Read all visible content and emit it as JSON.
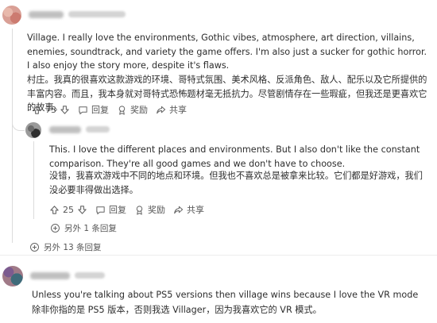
{
  "comment1": {
    "text_en": "Village. I really love the environments, Gothic vibes, atmosphere, art direction, villains, enemies, soundtrack, and variety the game offers. I'm also just a sucker for gothic horror. I also enjoy the story more, despite it's flaws.",
    "text_cn": "村庄。我真的很喜欢这款游戏的环境、哥特式氛围、美术风格、反派角色、敌人、配乐以及它所提供的丰富内容。而且，我本身就对哥特式恐怖题材毫无抵抗力。尽管剧情存在一些瑕疵，但我还是更喜欢它的故事。",
    "votes": "73",
    "reply_label": "回复",
    "award_label": "奖励",
    "share_label": "共享",
    "more_replies": "另外 13 条回复"
  },
  "comment2": {
    "text_en": "This. I love the different places and environments. But I also don't like the constant comparison. They're all good games and we don't have to choose.",
    "text_cn": "没错，我喜欢游戏中不同的地点和环境。但我也不喜欢总是被拿来比较。它们都是好游戏，我们没必要非得做出选择。",
    "votes": "25",
    "reply_label": "回复",
    "award_label": "奖励",
    "share_label": "共享",
    "more_replies": "另外 1 条回复"
  },
  "comment3": {
    "text_en": "Unless you're talking about PS5 versions then village wins because I love the VR mode",
    "text_cn": "除非你指的是 PS5 版本，否则我选 Villager，因为我喜欢它的 VR 模式。"
  },
  "icons": {
    "upvote": "arrow-up-icon",
    "downvote": "arrow-down-icon",
    "reply": "speech-bubble-icon",
    "award": "award-icon",
    "share": "share-icon",
    "expand": "plus-circle-icon"
  }
}
